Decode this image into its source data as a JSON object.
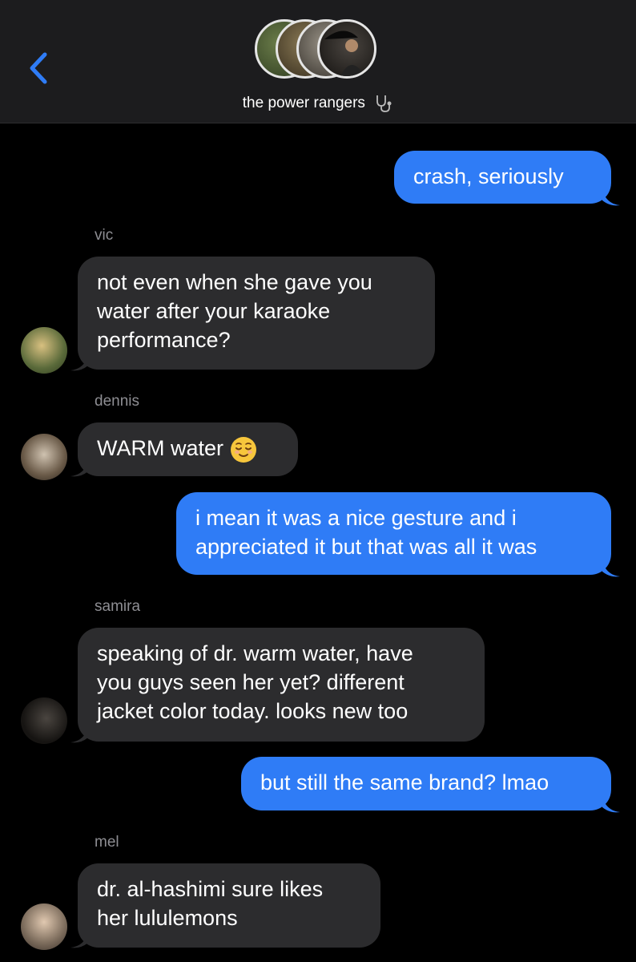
{
  "header": {
    "back_icon": "chevron-left-icon",
    "group_name": "the power rangers",
    "group_emoji": "stethoscope-icon",
    "colors": {
      "accent": "#2f7cf6",
      "header_bg": "#1c1c1e"
    }
  },
  "messages": [
    {
      "direction": "outgoing",
      "lines": [
        "crash, seriously"
      ]
    },
    {
      "direction": "incoming",
      "sender": "vic",
      "lines": [
        "not even when she gave you",
        "water after your karaoke",
        "performance?"
      ]
    },
    {
      "direction": "incoming",
      "sender": "dennis",
      "lines": [
        "WARM water"
      ],
      "emoji": "relieved-face-icon"
    },
    {
      "direction": "outgoing",
      "lines": [
        "i mean it was a nice gesture and i",
        "appreciated it but that was all it was"
      ]
    },
    {
      "direction": "incoming",
      "sender": "samira",
      "lines": [
        "speaking of dr. warm water, have",
        "you guys seen her yet? different",
        "jacket color today. looks new too"
      ]
    },
    {
      "direction": "outgoing",
      "lines": [
        "but still the same brand? lmao"
      ]
    },
    {
      "direction": "incoming",
      "sender": "mel",
      "lines": [
        "dr. al-hashimi sure likes",
        "her lululemons"
      ]
    }
  ],
  "colors": {
    "incoming_bubble": "#2c2c2e",
    "outgoing_bubble": "#2f7cf6",
    "sender_text": "#8e8e93"
  }
}
